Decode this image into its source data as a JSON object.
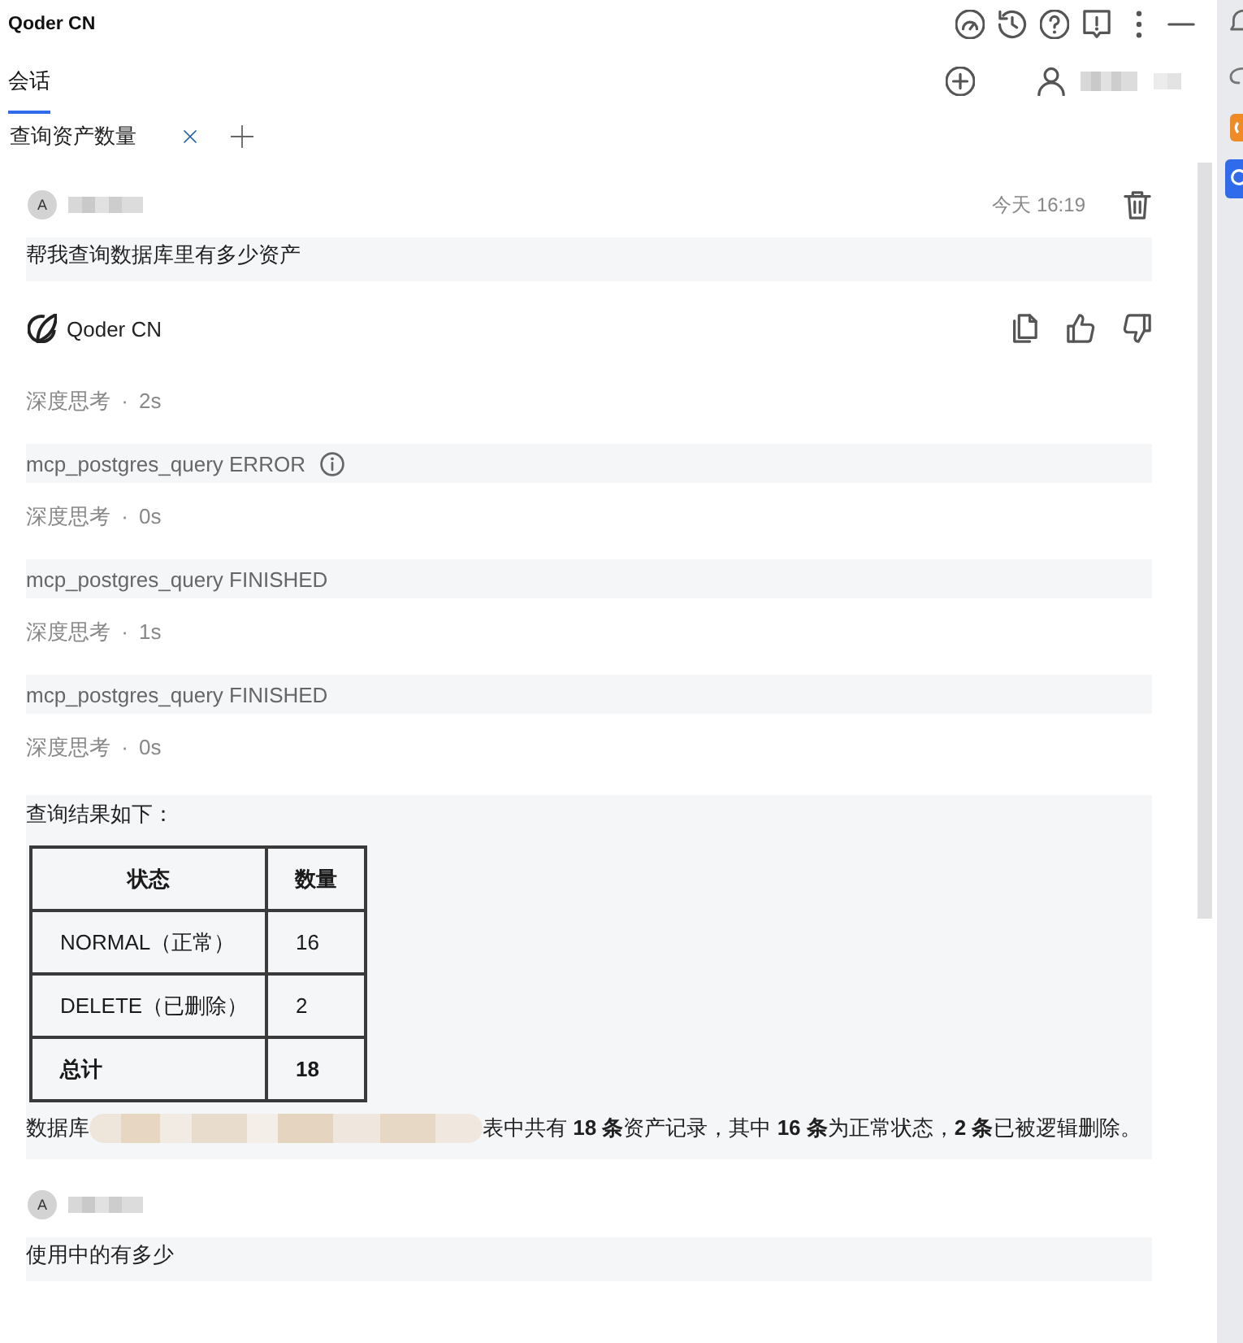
{
  "window": {
    "title": "Qoder CN"
  },
  "tabs": [
    {
      "label": "会话",
      "selected": true
    }
  ],
  "sessions": [
    {
      "title": "查询资产数量"
    }
  ],
  "messages": [
    {
      "kind": "user",
      "avatar": "A",
      "hovered": true,
      "time": "今天 16:19",
      "text": "帮我查询数据库里有多少资产"
    },
    {
      "kind": "assistant",
      "name": "Qoder CN",
      "steps": [
        {
          "kind": "thinking",
          "text": "深度思考 · 2s"
        },
        {
          "kind": "tool",
          "text": "mcp_postgres_query ERROR",
          "info_icon": true
        },
        {
          "kind": "thinking",
          "text": "深度思考 · 0s"
        },
        {
          "kind": "tool",
          "text": "mcp_postgres_query FINISHED",
          "info_icon": false
        },
        {
          "kind": "thinking",
          "text": "深度思考 · 1s"
        },
        {
          "kind": "tool",
          "text": "mcp_postgres_query FINISHED",
          "info_icon": false
        },
        {
          "kind": "thinking",
          "text": "深度思考 · 0s"
        }
      ],
      "result": {
        "intro": "查询结果如下：",
        "table": {
          "columns": [
            "状态",
            "数量"
          ],
          "rows": [
            {
              "cells": [
                "NORMAL（正常）",
                "16"
              ],
              "bold": false
            },
            {
              "cells": [
                "DELETE（已删除）",
                "2"
              ],
              "bold": false
            },
            {
              "cells": [
                "总计",
                "18"
              ],
              "bold": true
            }
          ]
        },
        "summary": {
          "before": "数据库",
          "after": "表中共有 **18 条**资产记录，其中 **16 条**为正常状态，**2 条**已被逻辑删除。"
        }
      }
    },
    {
      "kind": "user",
      "avatar": "A",
      "hovered": false,
      "text": "使用中的有多少"
    }
  ]
}
